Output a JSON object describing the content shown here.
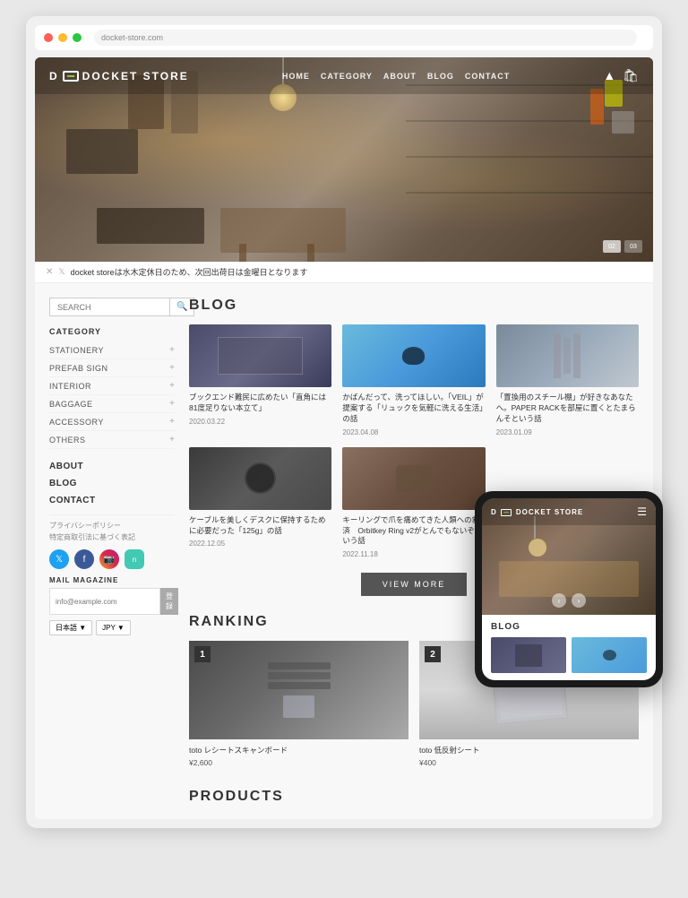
{
  "browser": {
    "url": "docket-store.com"
  },
  "site": {
    "logo": "DOCKET STORE",
    "logo_bracket": "DC",
    "nav": {
      "home": "HOME",
      "category": "CATEGORY",
      "about": "ABOUT",
      "blog": "BLOG",
      "contact": "CONTACT"
    }
  },
  "ticker": {
    "message": "docket storeは水木定休日のため、次回出荷日は金曜日となります"
  },
  "slider": {
    "dots": [
      "02",
      "03"
    ]
  },
  "sidebar": {
    "search_placeholder": "SEARCH",
    "category_title": "CATEGORY",
    "categories": [
      {
        "label": "STATIONERY"
      },
      {
        "label": "PREFAB SIGN"
      },
      {
        "label": "INTERIOR"
      },
      {
        "label": "BAGGAGE"
      },
      {
        "label": "ACCESSORY"
      },
      {
        "label": "OTHERS"
      }
    ],
    "about_label": "ABOUT",
    "blog_label": "BLOG",
    "contact_label": "CONTACT",
    "privacy_label": "プライバシーポリシー",
    "legal_label": "特定商取引法に基づく表記",
    "mail_mag_title": "MAIL MAGAZINE",
    "mail_placeholder": "info@example.com",
    "submit_label": "登録",
    "lang_options": [
      "日本語 ▼",
      "JPY ▼"
    ]
  },
  "blog": {
    "section_title": "BLOG",
    "posts": [
      {
        "title": "ブックエンド難民に広めたい「直角には81度足りない本立て」",
        "date": "2020.03.22",
        "thumb": "1"
      },
      {
        "title": "かばんだって、洗ってほしい。「VEIL」が提案する「リュックを気軽に洗える生活」の話",
        "date": "2023.04.08",
        "thumb": "2"
      },
      {
        "title": "「置換用のスチール棚」が好きなあなたへ。PAPER RACKを部屋に置くとたまらんそという話",
        "date": "2023.01.09",
        "thumb": "3"
      },
      {
        "title": "ケーブルを美しくデスクに保持するために必要だった「125g」の話",
        "date": "2022.12.05",
        "thumb": "4"
      },
      {
        "title": "キーリングで爪を痛めてきた人類への救済　Orbitkey Ring v2がとんでもないぞという話",
        "date": "2022.11.18",
        "thumb": "5"
      }
    ],
    "view_more": "VIEW MORE"
  },
  "ranking": {
    "section_title": "RANKING",
    "products": [
      {
        "rank": "1",
        "name": "toto レシートスキャンボード",
        "price": "¥2,600"
      },
      {
        "rank": "2",
        "name": "toto 低反射シート",
        "price": "¥400"
      }
    ]
  },
  "products": {
    "section_title": "PRODUCTS"
  },
  "mobile": {
    "logo": "DOCKET STORE",
    "blog_title": "BLOG"
  }
}
